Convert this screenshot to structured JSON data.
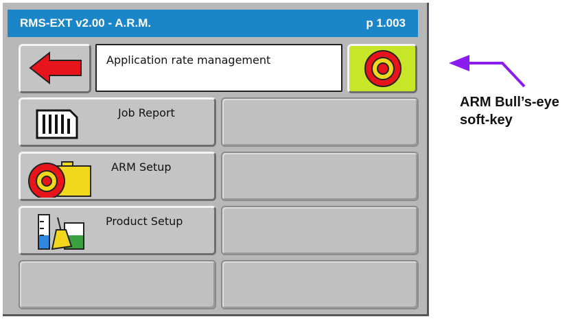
{
  "header": {
    "title": "RMS-EXT v2.00 - A.R.M.",
    "page": "p 1.003"
  },
  "top_row": {
    "back_button": {
      "icon": "red-left-arrow-icon"
    },
    "title_field": "Application rate management",
    "bullseye_key": {
      "icon": "bullseye-icon",
      "background": "#c8e628"
    }
  },
  "menu": [
    {
      "label": "Job Report",
      "icon": "report-document-icon"
    },
    {
      "label": "ARM Setup",
      "icon": "bullseye-tank-icon"
    },
    {
      "label": "Product Setup",
      "icon": "product-beakers-icon"
    }
  ],
  "callout": {
    "lines": [
      "ARM Bull’s-eye",
      "soft-key"
    ],
    "arrow_color": "#8b1cf0"
  },
  "colors": {
    "header_bg": "#1a86c8",
    "panel": "#b8b8b8",
    "red": "#e8141c",
    "yellow": "#f2d81c"
  }
}
